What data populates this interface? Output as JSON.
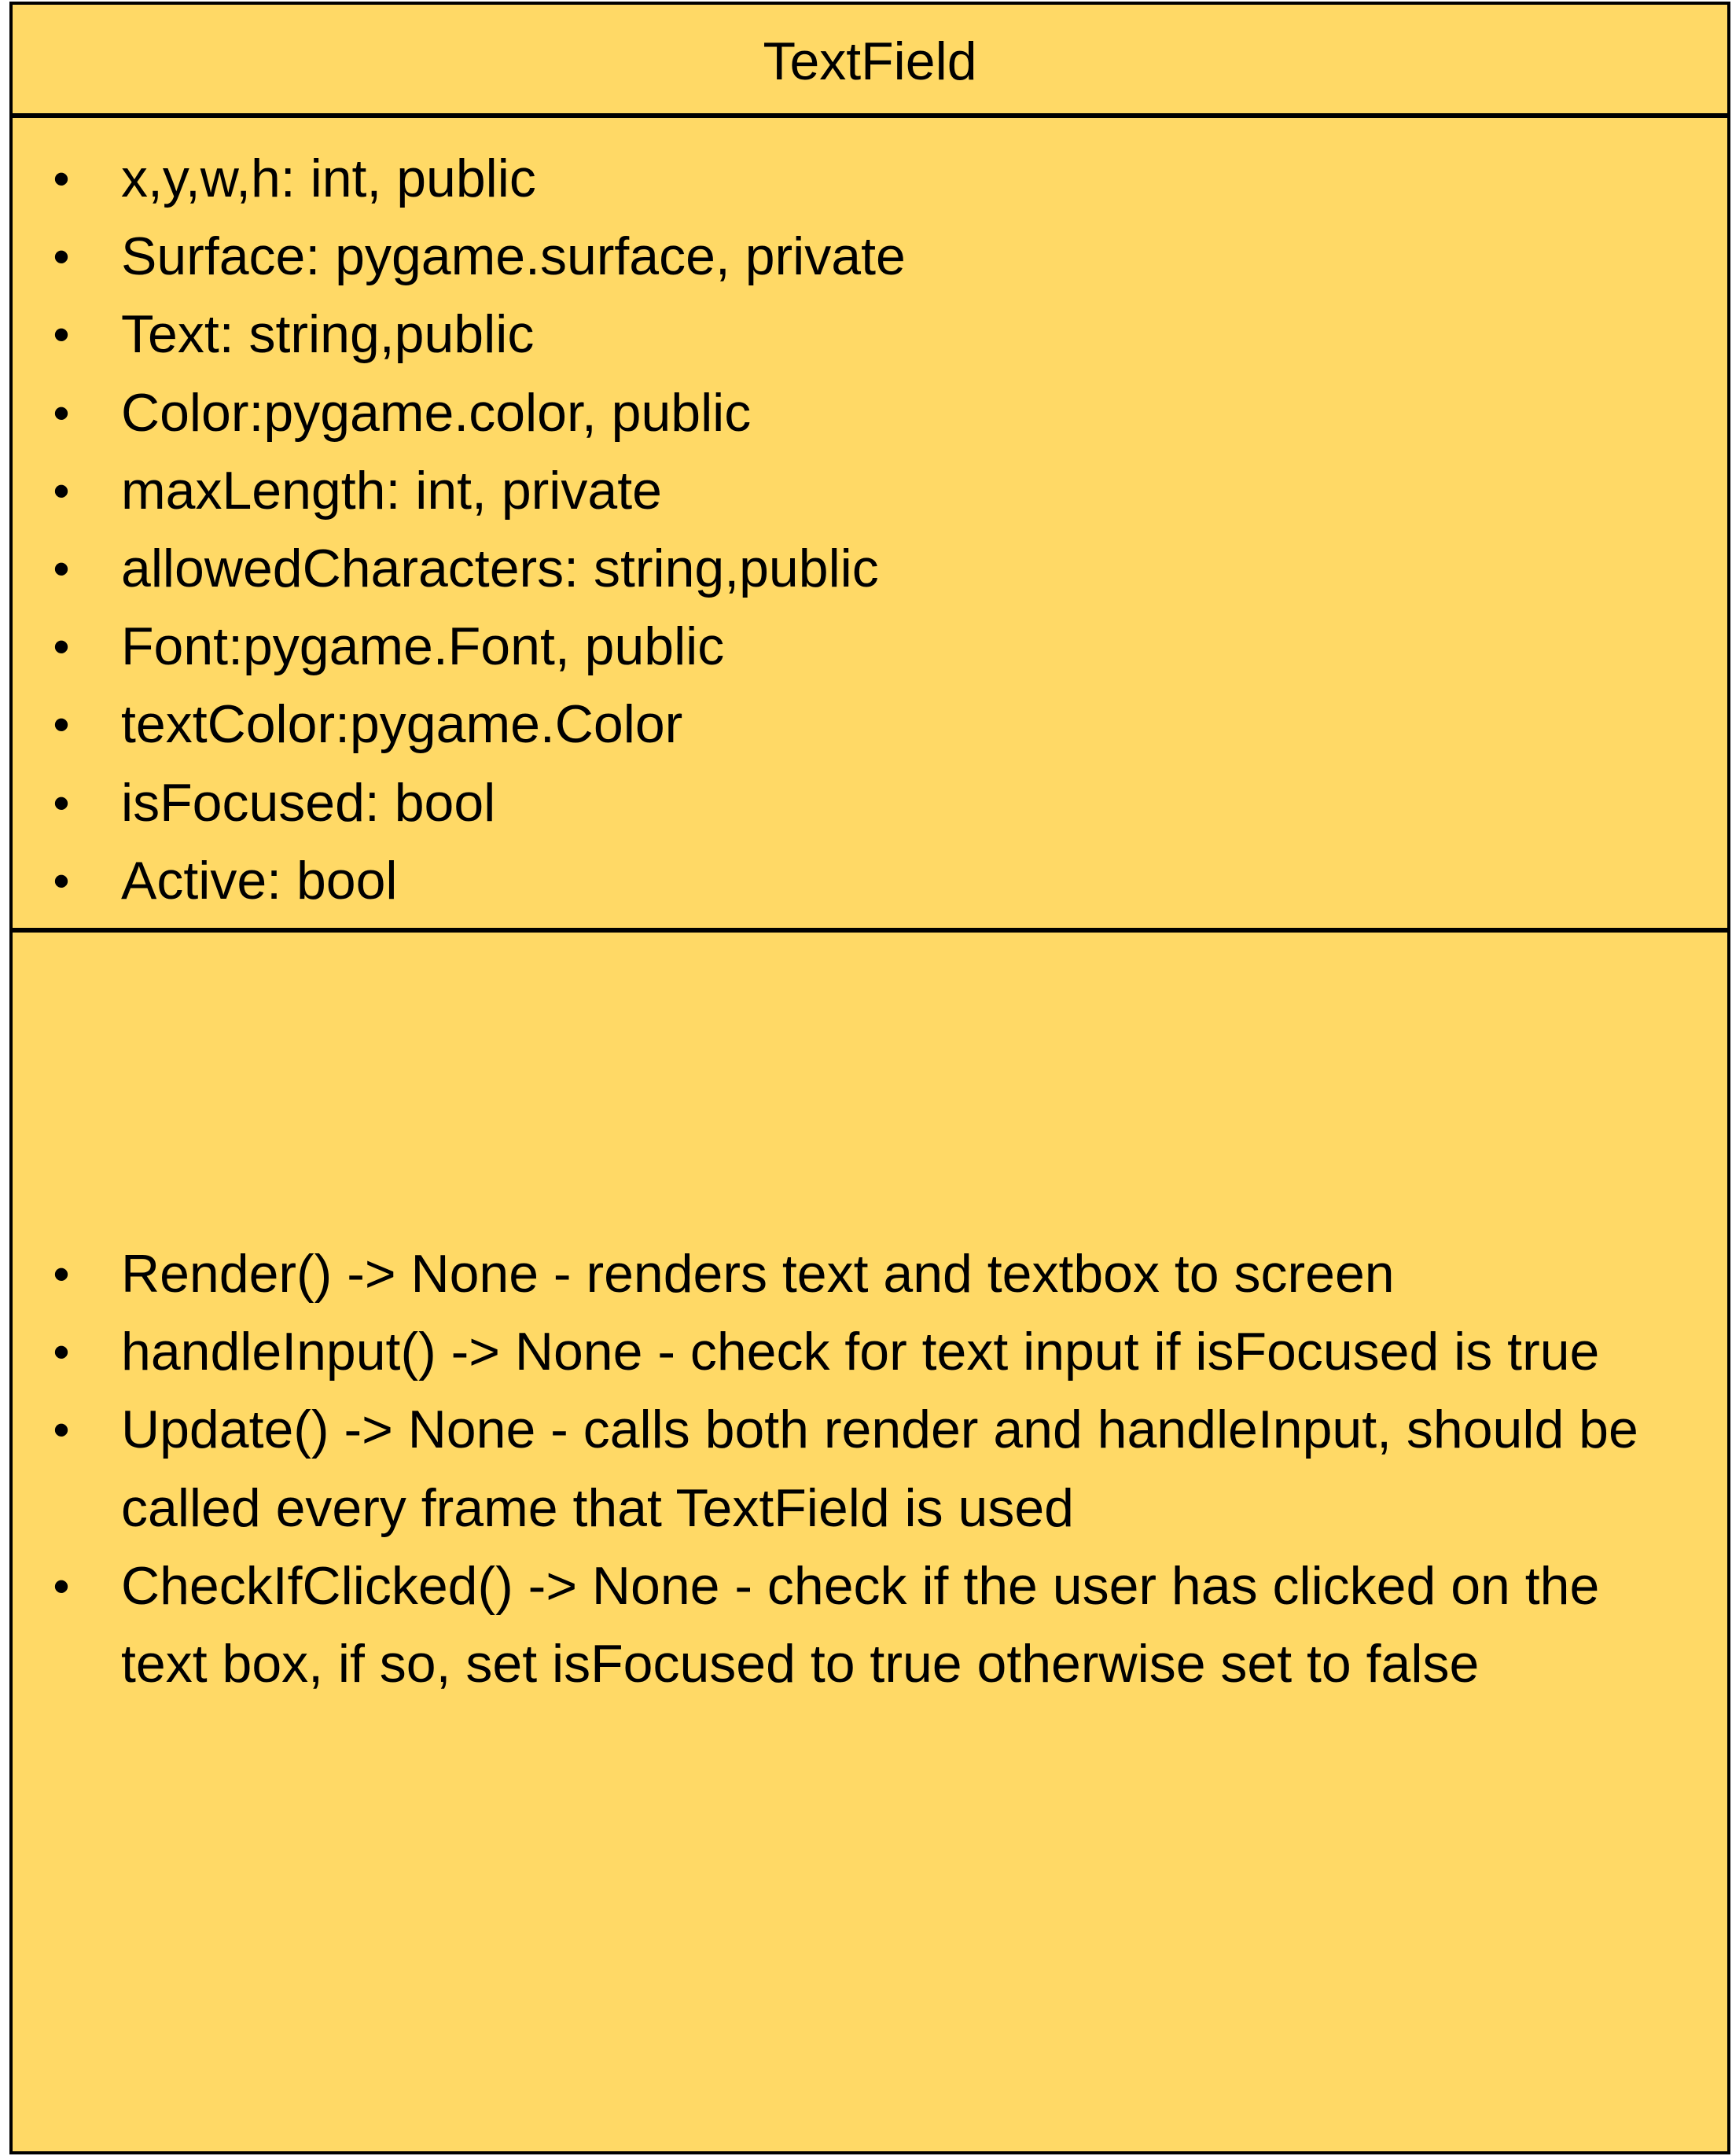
{
  "class_box": {
    "title": "TextField",
    "bullet": "•",
    "attributes": [
      "x,y,w,h: int, public",
      "Surface: pygame.surface, private",
      "Text: string,public",
      "Color:pygame.color, public",
      "maxLength: int, private",
      "allowedCharacters: string,public",
      "Font:pygame.Font, public",
      "textColor:pygame.Color",
      "isFocused: bool",
      "Active: bool"
    ],
    "methods": [
      "Render() -> None - renders text and textbox to screen",
      "handleInput() -> None - check for text input if isFocused is true",
      "Update() -> None - calls both render and handleInput, should be called every frame that TextField is used",
      "CheckIfClicked() -> None - check if the user has clicked on the text box, if so, set isFocused to true otherwise set to false"
    ]
  },
  "colors": {
    "fill": "#ffd966",
    "border": "#000000",
    "text": "#000000"
  }
}
